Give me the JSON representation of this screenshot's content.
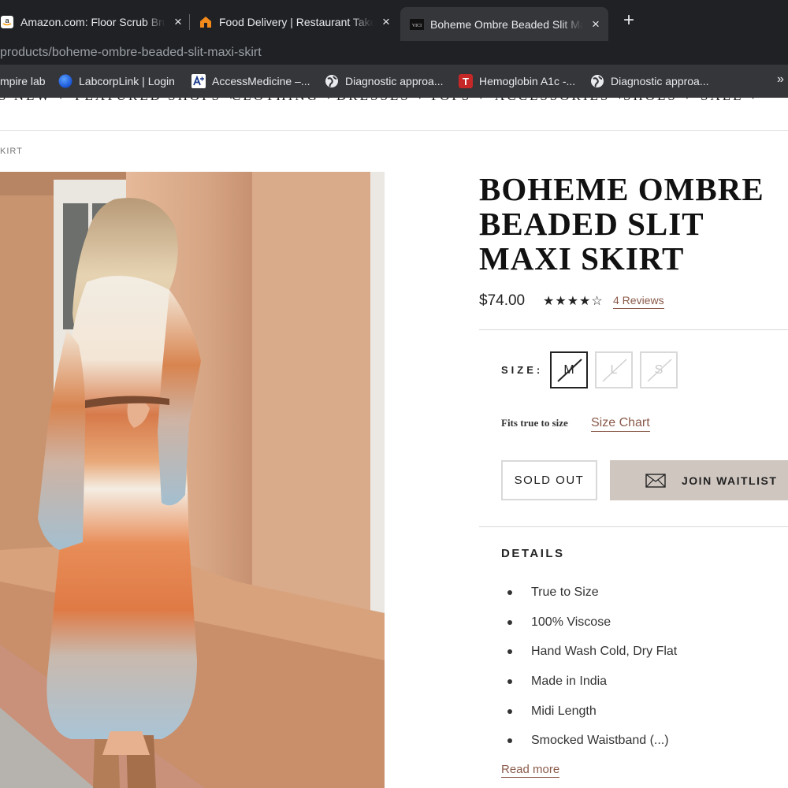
{
  "browser": {
    "tabs": [
      {
        "title": "Amazon.com: Floor Scrub Brush",
        "favicon": "amazon-icon"
      },
      {
        "title": "Food Delivery | Restaurant Takeout",
        "favicon": "grubhub-icon"
      },
      {
        "title": "Boheme Ombre Beaded Slit Maxi Skirt",
        "favicon": "vici-icon",
        "favicon_text": "VICI"
      }
    ],
    "new_tab_label": "+",
    "close_glyph": "×",
    "address": "products/boheme-ombre-beaded-slit-maxi-skirt",
    "bookmarks": [
      {
        "label": "mpire lab",
        "icon": "doc-icon"
      },
      {
        "label": "LabcorpLink | Login",
        "icon": "labcorp-icon"
      },
      {
        "label": "AccessMedicine –...",
        "icon": "accessmedicine-icon"
      },
      {
        "label": "Diagnostic approa...",
        "icon": "globe-icon"
      },
      {
        "label": "Hemoglobin A1c -...",
        "icon": "t-icon",
        "icon_text": "T"
      },
      {
        "label": "Diagnostic approa...",
        "icon": "globe-icon"
      }
    ],
    "bookmarks_overflow": "»"
  },
  "site_nav": [
    {
      "label": "S NEW ˅"
    },
    {
      "label": "FEATURED SHOPS ˅"
    },
    {
      "label": "CLOTHING ˅"
    },
    {
      "label": "DRESSES ˅"
    },
    {
      "label": "TOPS ˅"
    },
    {
      "label": "ACCESSORIES ˅"
    },
    {
      "label": "SHOES ˅"
    },
    {
      "label": "SALE ˅"
    }
  ],
  "breadcrumb": "KIRT",
  "product": {
    "title": "BOHEME OMBRE BEADED SLIT MAXI SKIRT",
    "price": "$74.00",
    "rating": 4,
    "rating_max": 5,
    "stars_text": "★★★★☆",
    "reviews_label": "4 Reviews",
    "size_label": "SIZE:",
    "sizes": [
      {
        "label": "M",
        "selected": true,
        "available": false
      },
      {
        "label": "L",
        "selected": false,
        "available": false
      },
      {
        "label": "S",
        "selected": false,
        "available": false
      }
    ],
    "fit_note": "Fits true to size",
    "size_chart_label": "Size Chart",
    "sold_out_label": "SOLD OUT",
    "waitlist_label": "JOIN WAITLIST",
    "details_heading": "DETAILS",
    "details": [
      "True to Size",
      "100% Viscose",
      "Hand Wash Cold, Dry Flat",
      "Made in India",
      "Midi Length",
      "Smocked Waistband (...)"
    ],
    "read_more_label": "Read more"
  },
  "colors": {
    "chrome_dark": "#202124",
    "chrome_mid": "#35363a",
    "link_brown": "#8a5a4a",
    "waitlist_bg": "#cfc6c0"
  }
}
